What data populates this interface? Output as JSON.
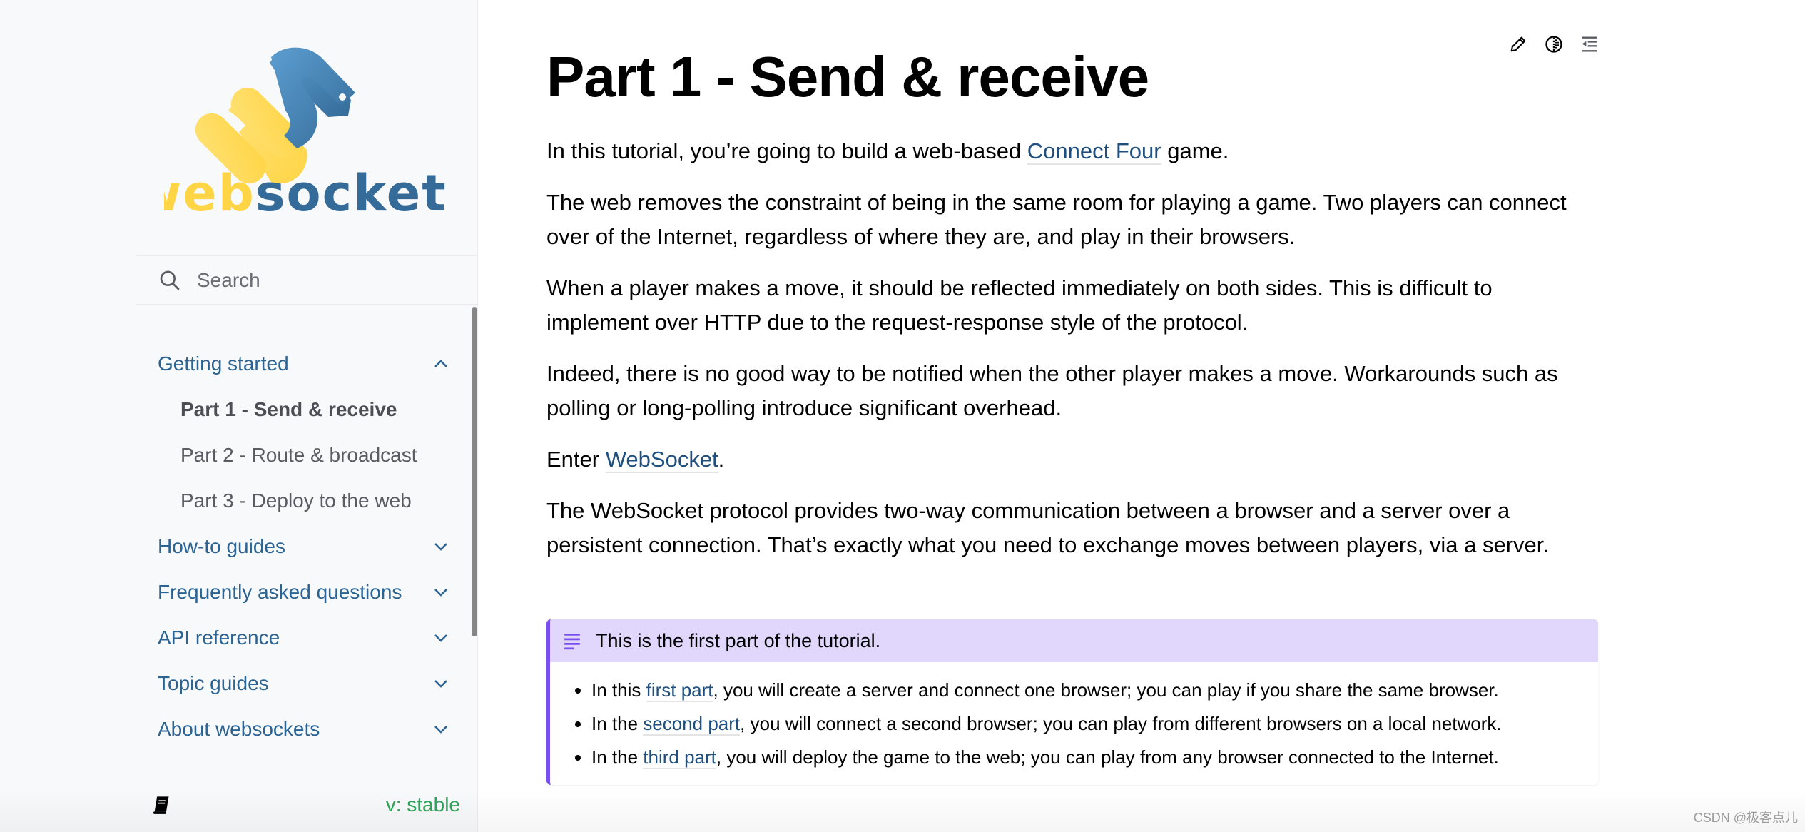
{
  "sidebar": {
    "logo_text_part1": "web",
    "logo_text_part2": "sockets",
    "search_placeholder": "Search",
    "nav": [
      {
        "label": "Getting started",
        "expanded": true,
        "level": 0
      },
      {
        "label": "Part 1 - Send & receive",
        "level": 1,
        "current": true
      },
      {
        "label": "Part 2 - Route & broadcast",
        "level": 1
      },
      {
        "label": "Part 3 - Deploy to the web",
        "level": 1
      },
      {
        "label": "How-to guides",
        "expanded": false,
        "level": 0
      },
      {
        "label": "Frequently asked questions",
        "expanded": false,
        "level": 0
      },
      {
        "label": "API reference",
        "expanded": false,
        "level": 0
      },
      {
        "label": "Topic guides",
        "expanded": false,
        "level": 0
      },
      {
        "label": "About websockets",
        "expanded": false,
        "level": 0
      }
    ],
    "version": "v: stable"
  },
  "toolbar": {
    "edit_icon": "pencil-icon",
    "theme_icon": "contrast-icon",
    "toc_icon": "toc-icon"
  },
  "page": {
    "title": "Part 1 - Send & receive",
    "p1": {
      "before": "In this tutorial, you’re going to build a web-based ",
      "link": "Connect Four",
      "after": " game."
    },
    "p2": "The web removes the constraint of being in the same room for playing a game. Two players can connect over of the Internet, regardless of where they are, and play in their browsers.",
    "p3": "When a player makes a move, it should be reflected immediately on both sides. This is difficult to implement over HTTP due to the request-response style of the protocol.",
    "p4": "Indeed, there is no good way to be notified when the other player makes a move. Workarounds such as polling or long-polling introduce significant overhead.",
    "p5": {
      "before": "Enter ",
      "link": "WebSocket",
      "after": "."
    },
    "p6": "The WebSocket protocol provides two-way communication between a browser and a server over a persistent connection. That’s exactly what you need to exchange moves between players, via a server.",
    "admonition": {
      "title": "This is the first part of the tutorial.",
      "items": [
        {
          "before": "In this ",
          "link": "first part",
          "after": ", you will create a server and connect one browser; you can play if you share the same browser."
        },
        {
          "before": "In the ",
          "link": "second part",
          "after": ", you will connect a second browser; you can play from different browsers on a local network."
        },
        {
          "before": "In the ",
          "link": "third part",
          "after": ", you will deploy the game to the web; you can play from any browser connected to the Internet."
        }
      ]
    }
  },
  "colors": {
    "link": "#1e4f7e",
    "nav": "#2b6392",
    "version": "#2ea55a",
    "admonition_accent": "#7a4ff1",
    "admonition_header": "#e1d7fd",
    "logo_yellow": "#ffd546",
    "logo_blue": "#346b98"
  },
  "watermark": "CSDN @极客点儿"
}
